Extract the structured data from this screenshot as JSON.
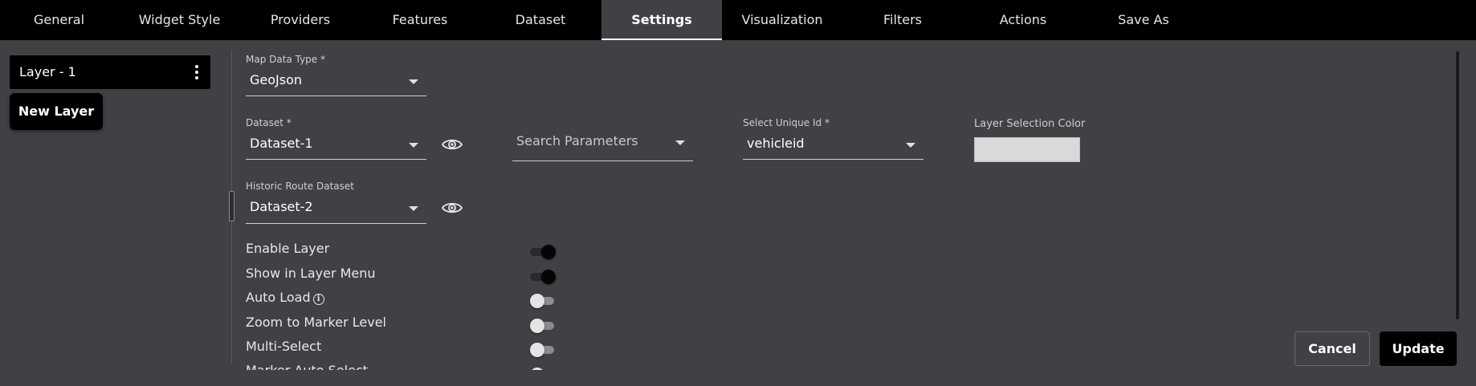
{
  "tabs": [
    {
      "label": "General",
      "active": false
    },
    {
      "label": "Widget Style",
      "active": false
    },
    {
      "label": "Providers",
      "active": false
    },
    {
      "label": "Features",
      "active": false
    },
    {
      "label": "Dataset",
      "active": false
    },
    {
      "label": "Settings",
      "active": true
    },
    {
      "label": "Visualization",
      "active": false
    },
    {
      "label": "Filters",
      "active": false
    },
    {
      "label": "Actions",
      "active": false
    },
    {
      "label": "Save As",
      "active": false
    }
  ],
  "layers": {
    "items": [
      {
        "label": "Layer - 1"
      }
    ],
    "new_layer_label": "New Layer"
  },
  "settings": {
    "map_data_type": {
      "label": "Map Data Type *",
      "value": "GeoJson"
    },
    "dataset": {
      "label": "Dataset *",
      "value": "Dataset-1"
    },
    "search_parameters": {
      "placeholder": "Search Parameters"
    },
    "unique_id": {
      "label": "Select Unique Id *",
      "value": "vehicleid"
    },
    "layer_selection_color": {
      "label": "Layer Selection Color",
      "value": "#d9d9d9"
    },
    "historic_route_dataset": {
      "label": "Historic Route Dataset",
      "value": "Dataset-2"
    }
  },
  "toggles": [
    {
      "label": "Enable Layer",
      "on": true,
      "info": false
    },
    {
      "label": "Show in Layer Menu",
      "on": true,
      "info": false
    },
    {
      "label": "Auto Load",
      "on": false,
      "info": true
    },
    {
      "label": "Zoom to Marker Level",
      "on": false,
      "info": false
    },
    {
      "label": "Multi-Select",
      "on": false,
      "info": false
    },
    {
      "label": "Marker Auto Select",
      "on": false,
      "info": false
    }
  ],
  "footer": {
    "cancel_label": "Cancel",
    "update_label": "Update"
  }
}
